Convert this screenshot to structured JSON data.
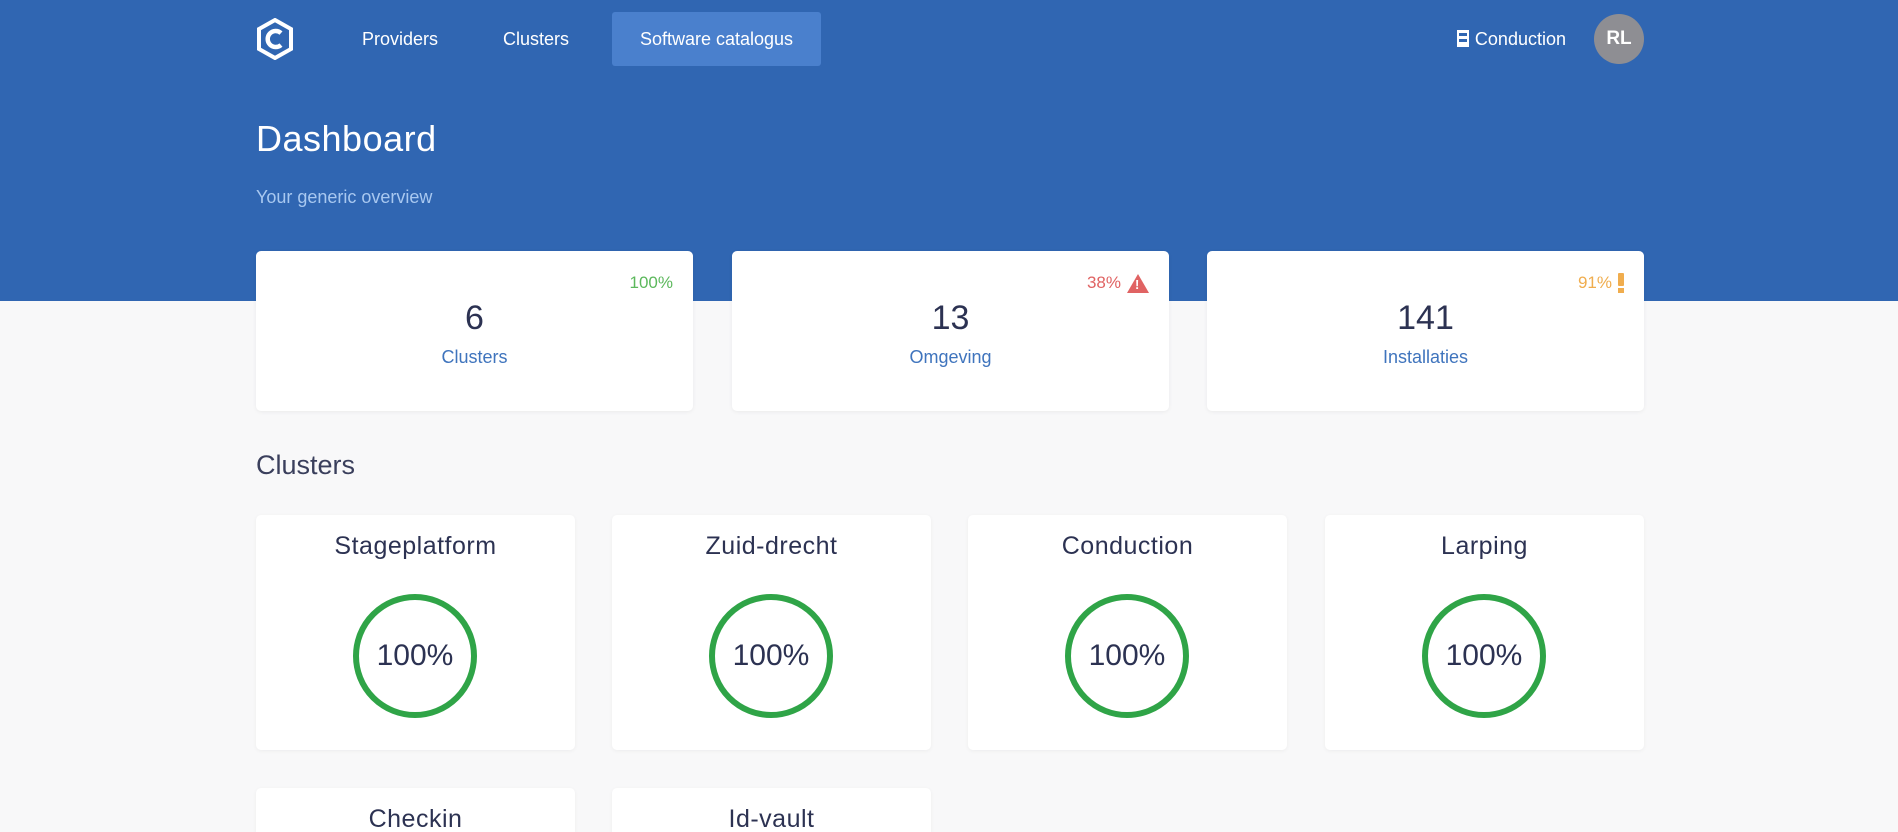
{
  "nav": {
    "links": [
      "Providers",
      "Clusters",
      "Software catalogus"
    ],
    "active": "Software catalogus",
    "organization": "Conduction",
    "avatar_initials": "RL"
  },
  "header": {
    "title": "Dashboard",
    "subtitle": "Your generic overview"
  },
  "stats": [
    {
      "percent": "100%",
      "value": "6",
      "label": "Clusters",
      "status": "ok",
      "status_color": "#5cb85c",
      "icon": ""
    },
    {
      "percent": "38%",
      "value": "13",
      "label": "Omgeving",
      "status": "danger",
      "status_color": "#e06363",
      "icon": "warning-triangle-icon"
    },
    {
      "percent": "91%",
      "value": "141",
      "label": "Installaties",
      "status": "warning",
      "status_color": "#f0ad4e",
      "icon": "exclamation-icon"
    }
  ],
  "clusters_section": {
    "title": "Clusters",
    "items": [
      {
        "name": "Stageplatform",
        "health": "100%"
      },
      {
        "name": "Zuid-drecht",
        "health": "100%"
      },
      {
        "name": "Conduction",
        "health": "100%"
      },
      {
        "name": "Larping",
        "health": "100%"
      },
      {
        "name": "Checkin",
        "health": ""
      },
      {
        "name": "Id-vault",
        "health": ""
      }
    ]
  },
  "colors": {
    "header_bg": "#3066b2",
    "active_nav_bg": "#4a80cd",
    "ring": "#2fa447",
    "page_bg": "#f8f8f9"
  }
}
